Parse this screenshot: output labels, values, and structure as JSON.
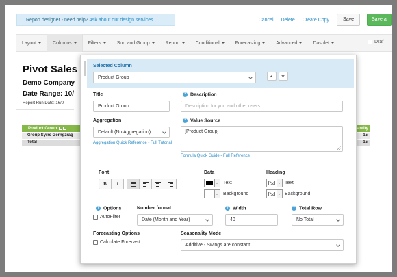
{
  "top_bar": {
    "help_text": "Report designer - need help?",
    "help_link": "Ask about our design services.",
    "cancel": "Cancel",
    "delete": "Delete",
    "create_copy": "Create Copy",
    "save": "Save",
    "save_as": "Save a"
  },
  "menu": {
    "items": [
      "Layout",
      "Columns",
      "Filters",
      "Sort and Group",
      "Report",
      "Conditional",
      "Forecasting",
      "Advanced",
      "Dashlet"
    ],
    "draft": "Draf"
  },
  "report": {
    "title": "Pivot Sales",
    "company": "Demo Company",
    "date_range": "Date Range: 10/",
    "run_date": "Report Run Date: 16/0",
    "pivot_header": "Product Group",
    "pivot_row1": "Group Syrrc Gerngzrag",
    "pivot_row2": "Total",
    "quantity_header": "antity",
    "quantity_row1": "15",
    "quantity_row2": "15"
  },
  "panel": {
    "selected_column_label": "Selected Column",
    "selected_column_value": "Product Group",
    "title_label": "Title",
    "title_value": "Product Group",
    "description_label": "Description",
    "description_placeholder": "Description for you and other users...",
    "aggregation_label": "Aggregation",
    "aggregation_value": "Default (No Aggregation)",
    "aggregation_help": "Aggregation Quick Reference - Full Tutorial",
    "value_source_label": "Value Source",
    "value_source_value": "[Product Group]",
    "formula_help": "Formula Quick Guide - Full Reference",
    "font_label": "Font",
    "data_label": "Data",
    "heading_label": "Heading",
    "text_label": "Text",
    "background_label": "Background",
    "heading_text_label": "Text",
    "heading_background_label": "Background",
    "options_label": "Options",
    "autofilter_label": "AutoFilter",
    "number_format_label": "Number format",
    "number_format_value": "Date (Month and Year)",
    "width_label": "Width",
    "width_value": "40",
    "total_row_label": "Total Row",
    "total_row_value": "No Total",
    "forecasting_options_label": "Forecasting Options",
    "calculate_forecast_label": "Calculate Forecast",
    "seasonality_label": "Seasonality Mode",
    "seasonality_value": "Additive - Swings are constant",
    "font_buttons": [
      "B",
      "I"
    ],
    "data_text_color": "#000000",
    "data_background_color": "#ffffff"
  }
}
